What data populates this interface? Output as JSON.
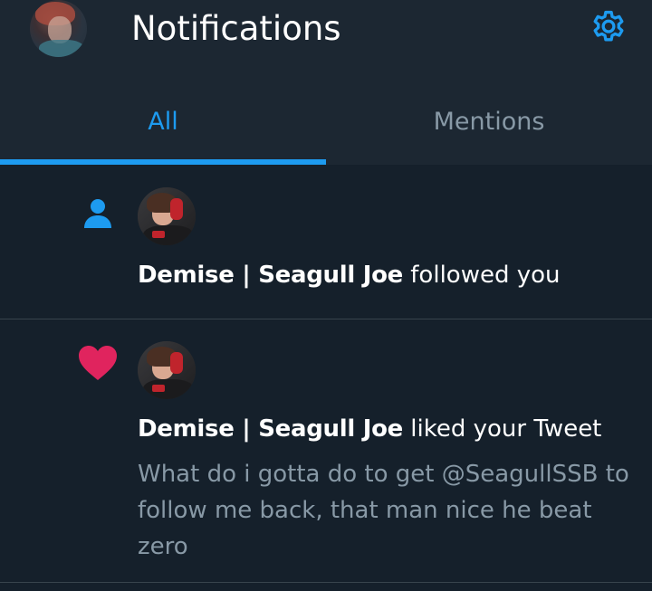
{
  "header": {
    "title": "Notifications",
    "avatar_icon": "profile-avatar",
    "settings_icon": "gear-icon"
  },
  "tabs": [
    {
      "label": "All",
      "active": true
    },
    {
      "label": "Mentions",
      "active": false
    }
  ],
  "colors": {
    "accent": "#1d9bf0",
    "background": "#15202b",
    "header_bg": "#1c2732",
    "like": "#e0245e",
    "secondary_text": "#8899a6"
  },
  "notifications": [
    {
      "type_icon": "person-icon",
      "user_name": "Demise | Seagull Joe",
      "action": " followed you",
      "snippet": ""
    },
    {
      "type_icon": "heart-icon",
      "user_name": "Demise | Seagull Joe",
      "action": " liked your Tweet",
      "snippet": "What do i gotta do to get @SeagullSSB to follow me back, that man nice he beat zero"
    }
  ]
}
